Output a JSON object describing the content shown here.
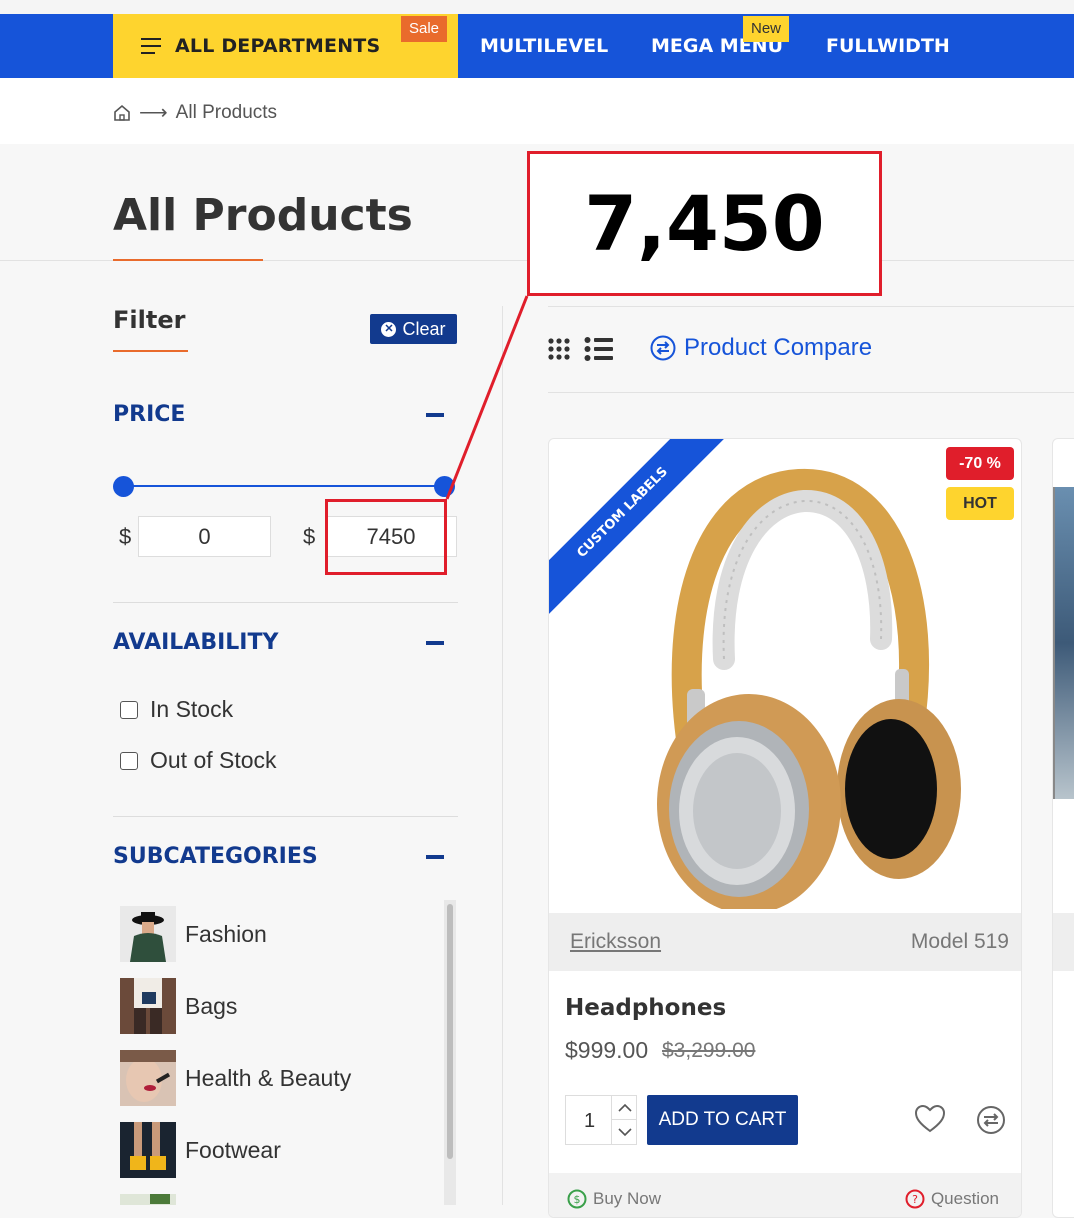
{
  "nav": {
    "departments_label": "ALL DEPARTMENTS",
    "sale_badge": "Sale",
    "links": [
      "MULTILEVEL",
      "MEGA MENU",
      "FULLWIDTH"
    ],
    "new_badge": "New"
  },
  "breadcrumb": {
    "home_icon": "home-icon",
    "current": "All Products"
  },
  "page": {
    "title": "All Products"
  },
  "filter": {
    "title": "Filter",
    "clear_label": "Clear",
    "price": {
      "title": "PRICE",
      "currency": "$",
      "min_value": "0",
      "max_value": "7450"
    },
    "availability": {
      "title": "AVAILABILITY",
      "options": [
        "In Stock",
        "Out of Stock"
      ]
    },
    "subcategories": {
      "title": "SUBCATEGORIES",
      "items": [
        "Fashion",
        "Bags",
        "Health & Beauty",
        "Footwear"
      ]
    }
  },
  "toolbar": {
    "compare_label": "Product Compare"
  },
  "product": {
    "ribbon": "CUSTOM LABELS",
    "discount": "-70 %",
    "hot": "HOT",
    "brand": "Ericksson",
    "model": "Model 519",
    "name": "Headphones",
    "price": "$999.00",
    "old_price": "$3,299.00",
    "qty": "1",
    "add_to_cart": "ADD TO CART",
    "buy_now": "Buy Now",
    "question": "Question"
  },
  "annotation": {
    "value": "7,450",
    "color": "#e01e2b"
  },
  "colors": {
    "nav_blue": "#1654d9",
    "dept_yellow": "#fed42e",
    "dark_blue": "#123a8e",
    "accent_orange": "#e96b2c"
  }
}
